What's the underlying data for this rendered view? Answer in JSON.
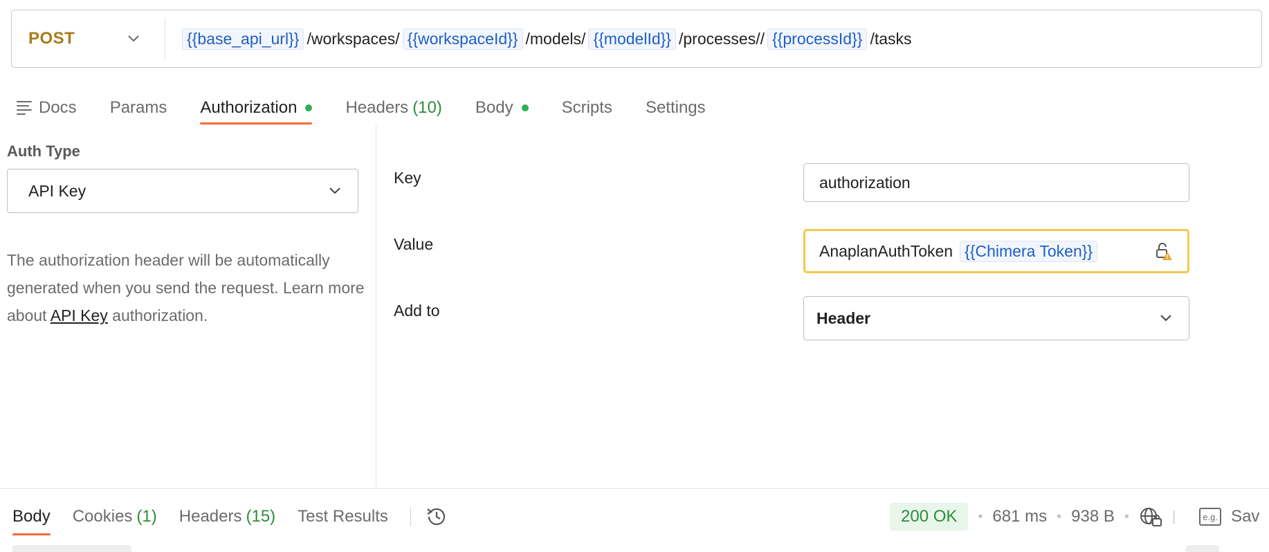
{
  "request": {
    "method": "POST",
    "url_parts": [
      {
        "type": "var",
        "text": "{{base_api_url}}"
      },
      {
        "type": "text",
        "text": "/workspaces/"
      },
      {
        "type": "var",
        "text": "{{workspaceId}}"
      },
      {
        "type": "text",
        "text": "/models/"
      },
      {
        "type": "var",
        "text": "{{modelId}}"
      },
      {
        "type": "text",
        "text": "/processes//"
      },
      {
        "type": "var",
        "text": "{{processId}}"
      },
      {
        "type": "text",
        "text": "/tasks"
      }
    ]
  },
  "tabs": {
    "docs": "Docs",
    "params": "Params",
    "authorization": "Authorization",
    "headers": "Headers",
    "headers_count": "(10)",
    "body": "Body",
    "scripts": "Scripts",
    "settings": "Settings"
  },
  "auth": {
    "type_label": "Auth Type",
    "type_value": "API Key",
    "description_pre": "The authorization header will be automatically generated when you send the request. Learn more about ",
    "description_link": "API Key",
    "description_post": " authorization."
  },
  "fields": {
    "key_label": "Key",
    "key_value": "authorization",
    "value_label": "Value",
    "value_text": "AnaplanAuthToken",
    "value_var": "{{Chimera Token}}",
    "addto_label": "Add to",
    "addto_value": "Header"
  },
  "response": {
    "tabs": {
      "body": "Body",
      "cookies": "Cookies",
      "cookies_count": "(1)",
      "headers": "Headers",
      "headers_count": "(15)",
      "test_results": "Test Results"
    },
    "status": "200 OK",
    "time": "681 ms",
    "size": "938 B",
    "save_label": "Sav",
    "eg_label": "e.g."
  },
  "colors": {
    "accent": "#f26b3a",
    "method": "#a87b1c",
    "variable": "#1f5fc4",
    "success": "#2e8b3e",
    "warning": "#f2c94c"
  }
}
